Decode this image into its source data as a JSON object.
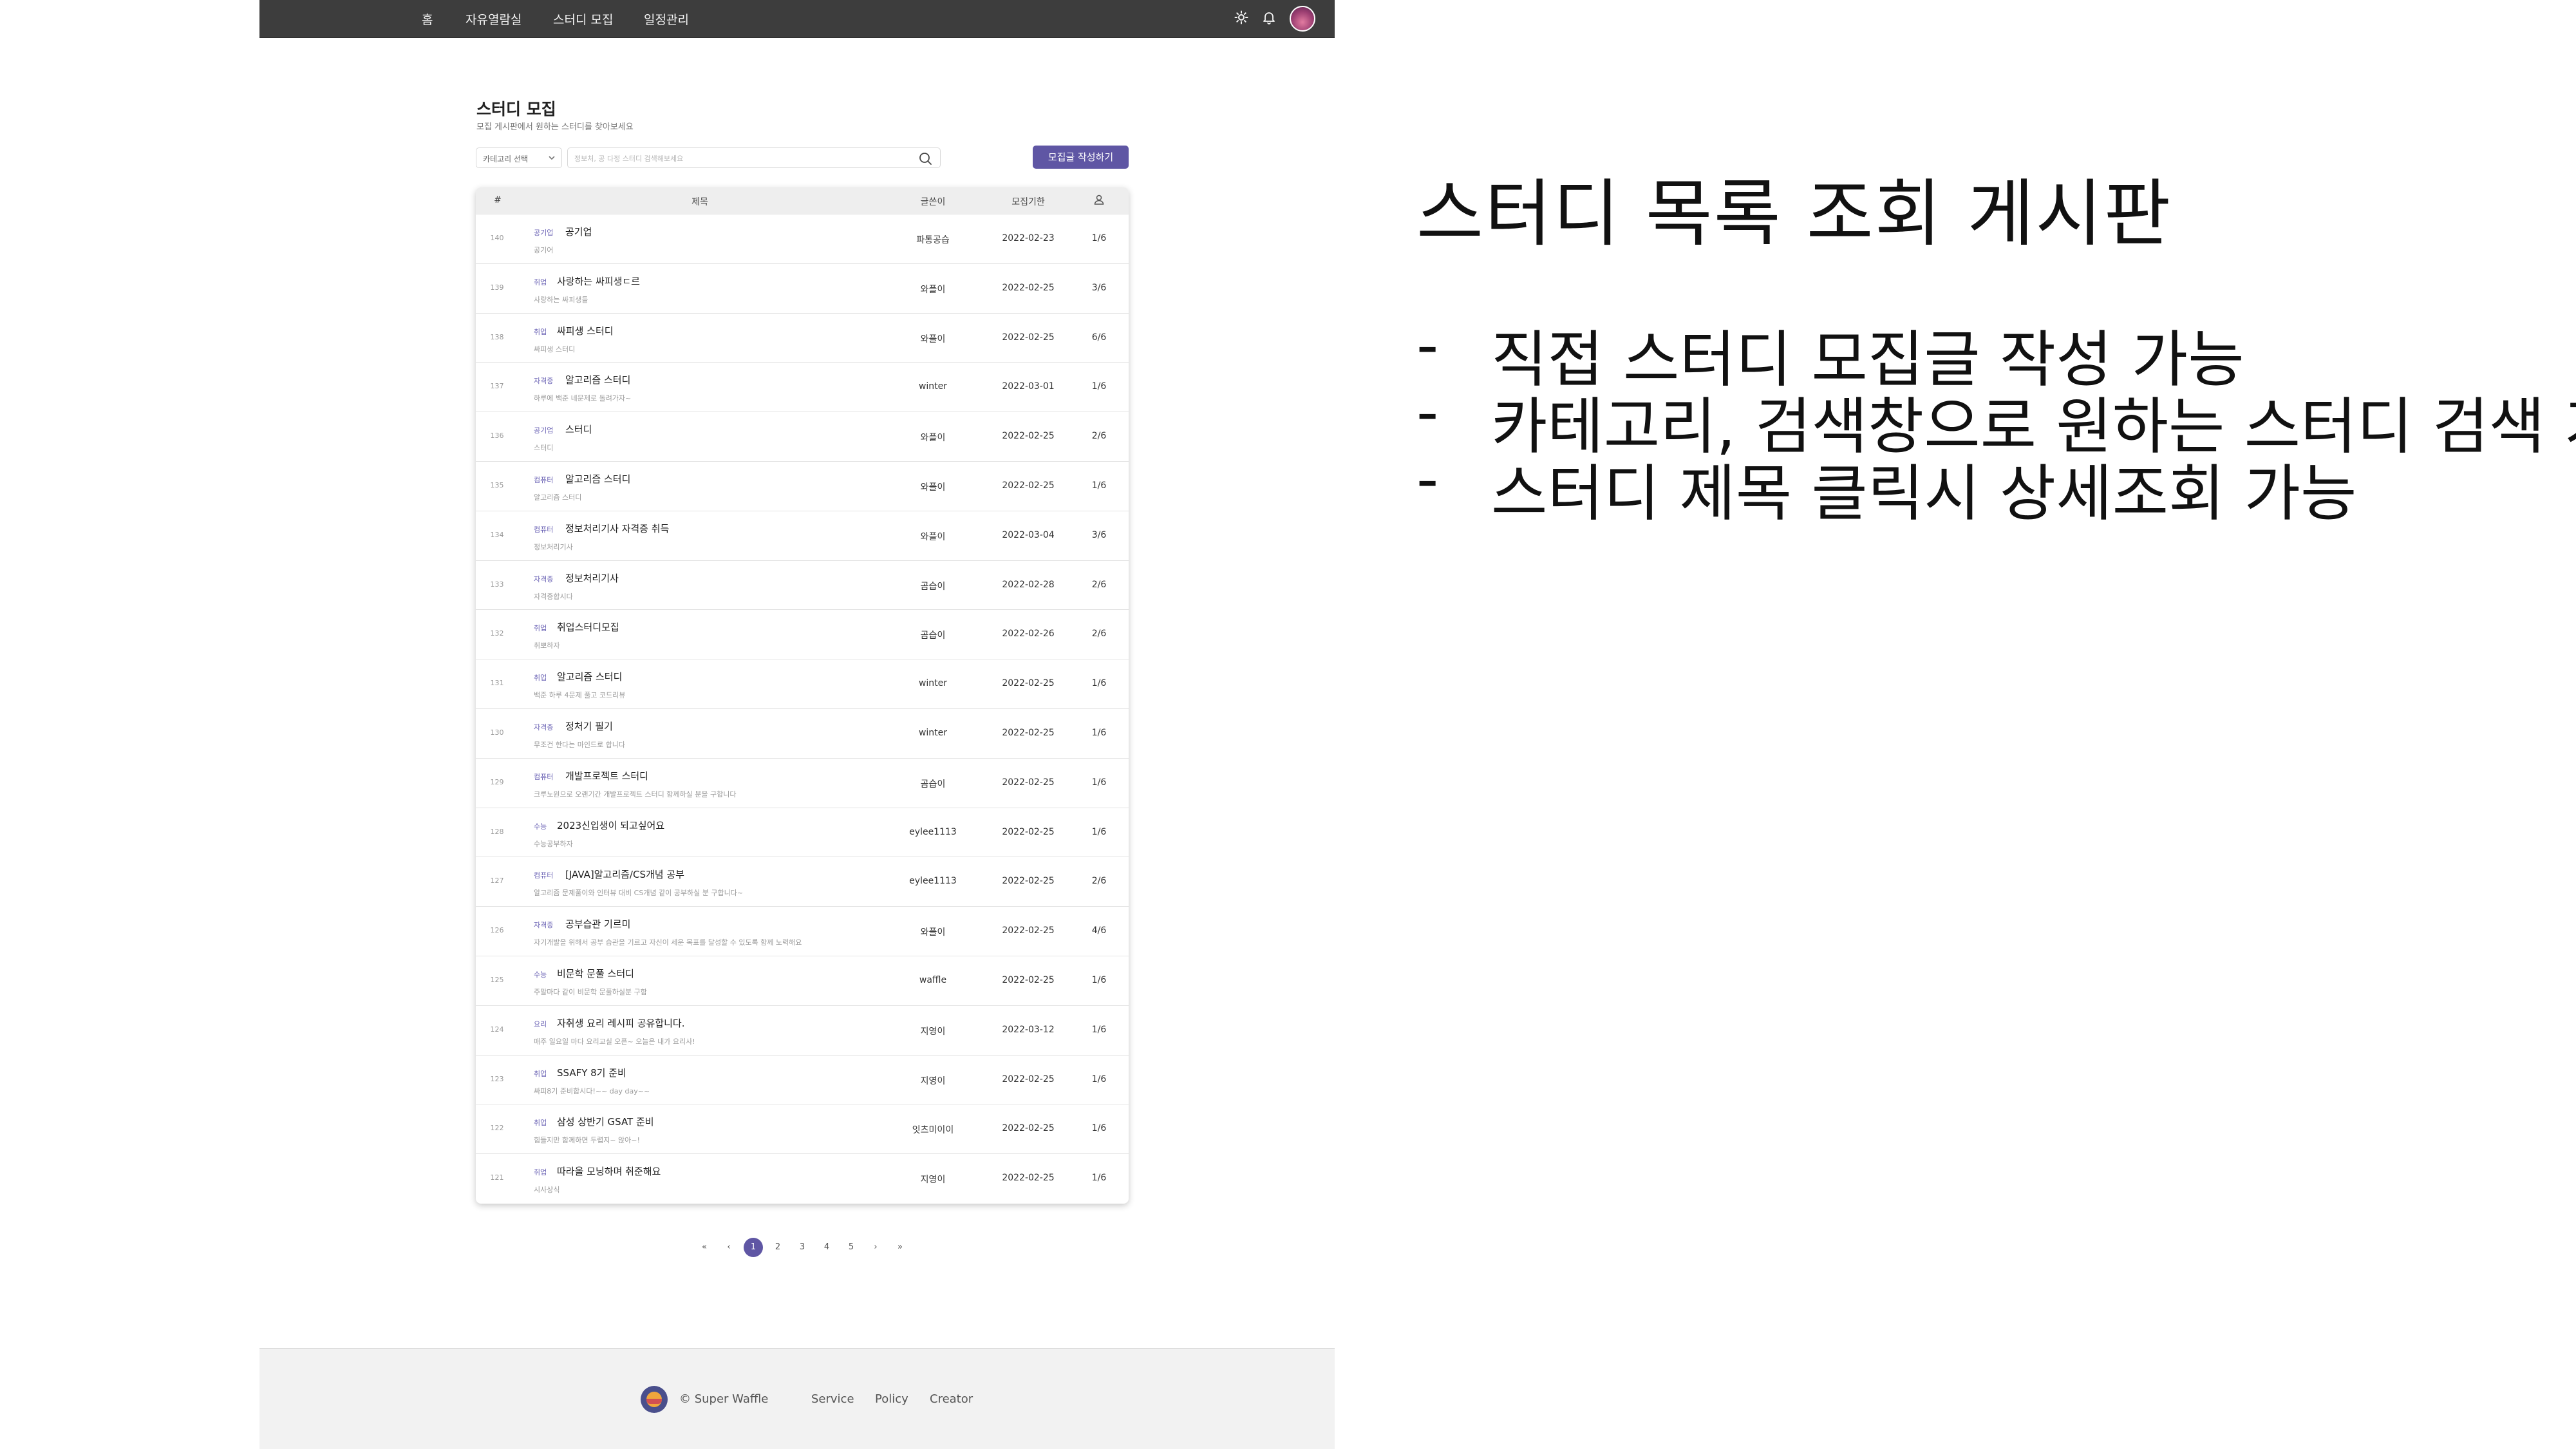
{
  "navbar": {
    "links": [
      "홈",
      "자유열람실",
      "스터디 모집",
      "일정관리"
    ]
  },
  "page": {
    "title": "스터디 모집",
    "subtitle": "모집 게시판에서 원하는 스터디를 찾아보세요"
  },
  "search": {
    "category_label": "카테고리 선택",
    "placeholder": "정보처, 공 다정 스터디 검색해보세요",
    "write_button": "모집글 작성하기"
  },
  "table": {
    "headers": [
      "#",
      "제목",
      "글쓴이",
      "모집기한"
    ],
    "rows": [
      {
        "num": "140",
        "category": "공기업",
        "title": "공기업",
        "desc": "공기어",
        "author": "파통공습",
        "deadline": "2022-02-23",
        "members": "1/6"
      },
      {
        "num": "139",
        "category": "취업",
        "title": "사랑하는 싸피생ㄷ르",
        "desc": "사랑하는 싸피생들",
        "author": "와플이",
        "deadline": "2022-02-25",
        "members": "3/6"
      },
      {
        "num": "138",
        "category": "취업",
        "title": "싸피생 스터디",
        "desc": "싸피생 스터디",
        "author": "와플이",
        "deadline": "2022-02-25",
        "members": "6/6"
      },
      {
        "num": "137",
        "category": "자격증",
        "title": "알고리즘 스터디",
        "desc": "하루에 백준 네문제로 돌려가자~",
        "author": "winter",
        "deadline": "2022-03-01",
        "members": "1/6"
      },
      {
        "num": "136",
        "category": "공기업",
        "title": "스터디",
        "desc": "스터디",
        "author": "와플이",
        "deadline": "2022-02-25",
        "members": "2/6"
      },
      {
        "num": "135",
        "category": "컴퓨터",
        "title": "알고리즘 스터디",
        "desc": "알고리즘 스터디",
        "author": "와플이",
        "deadline": "2022-02-25",
        "members": "1/6"
      },
      {
        "num": "134",
        "category": "컴퓨터",
        "title": "정보처리기사 자격증 취득",
        "desc": "정보처리기사",
        "author": "와플이",
        "deadline": "2022-03-04",
        "members": "3/6"
      },
      {
        "num": "133",
        "category": "자격증",
        "title": "정보처리기사",
        "desc": "자격증합시다",
        "author": "곰습이",
        "deadline": "2022-02-28",
        "members": "2/6"
      },
      {
        "num": "132",
        "category": "취업",
        "title": "취업스터디모집",
        "desc": "취뽀하자",
        "author": "곰습이",
        "deadline": "2022-02-26",
        "members": "2/6"
      },
      {
        "num": "131",
        "category": "취업",
        "title": "알고리즘 스터디",
        "desc": "백준 하루 4문제 풀고 코드리뷰",
        "author": "winter",
        "deadline": "2022-02-25",
        "members": "1/6"
      },
      {
        "num": "130",
        "category": "자격증",
        "title": "정처기 필기",
        "desc": "무조건 한다는 마인드로 합니다",
        "author": "winter",
        "deadline": "2022-02-25",
        "members": "1/6"
      },
      {
        "num": "129",
        "category": "컴퓨터",
        "title": "개발프로젝트 스터디",
        "desc": "크루노원으로 오랜기간 개발프로젝트 스터디 함께하실 분을 구합니다",
        "author": "곰습이",
        "deadline": "2022-02-25",
        "members": "1/6"
      },
      {
        "num": "128",
        "category": "수능",
        "title": "2023신입생이 되고싶어요",
        "desc": "수능공부하자",
        "author": "eylee1113",
        "deadline": "2022-02-25",
        "members": "1/6"
      },
      {
        "num": "127",
        "category": "컴퓨터",
        "title": "[JAVA]알고리즘/CS개념 공부",
        "desc": "알고리즘 문제풀이와 인터뷰 대비 CS개념 같이 공부하실 분 구합니다~",
        "author": "eylee1113",
        "deadline": "2022-02-25",
        "members": "2/6"
      },
      {
        "num": "126",
        "category": "자격증",
        "title": "공부습관 기르미",
        "desc": "자기개발을 위해서 공부 습관을 기르고 자신이 세운 목표를 달성할 수 있도록 함께 노력해요",
        "author": "와플이",
        "deadline": "2022-02-25",
        "members": "4/6"
      },
      {
        "num": "125",
        "category": "수능",
        "title": "비문학 문풀 스터디",
        "desc": "주말마다 같이 비문학 문풀하실분 구함",
        "author": "waffle",
        "deadline": "2022-02-25",
        "members": "1/6"
      },
      {
        "num": "124",
        "category": "요리",
        "title": "자취생 요리 레시피 공유합니다.",
        "desc": "매주 일요일 마다 요리교실 오픈~ 오늘은 내가 요리사!",
        "author": "지영이",
        "deadline": "2022-03-12",
        "members": "1/6"
      },
      {
        "num": "123",
        "category": "취업",
        "title": "SSAFY 8기 준비",
        "desc": "싸피8기 준비합시다!~~ day day~~",
        "author": "지영이",
        "deadline": "2022-02-25",
        "members": "1/6"
      },
      {
        "num": "122",
        "category": "취업",
        "title": "삼성 상반기 GSAT 준비",
        "desc": "힘들지만 함께하면 두렵지~ 않아~!",
        "author": "잇츠미이이",
        "deadline": "2022-02-25",
        "members": "1/6"
      },
      {
        "num": "121",
        "category": "취업",
        "title": "따라올 모닝하며 취준해요",
        "desc": "시사상식",
        "author": "지영이",
        "deadline": "2022-02-25",
        "members": "1/6"
      }
    ]
  },
  "pagination": {
    "first": "«",
    "prev": "‹",
    "pages": [
      "1",
      "2",
      "3",
      "4",
      "5"
    ],
    "active": "1",
    "next": "›",
    "last": "»"
  },
  "footer": {
    "copyright": "© Super Waffle",
    "links": [
      "Service",
      "Policy",
      "Creator"
    ]
  },
  "slide": {
    "title": "스터디 목록 조회 게시판",
    "bullets": [
      "직접 스터디 모집글 작성 가능",
      "카테고리, 검색창으로 원하는 스터디 검색 가능",
      "스터디 제목 클릭시 상세조회 가능"
    ],
    "dash": "-"
  },
  "icons": {
    "theme": "sun-icon",
    "notifications": "bell-icon",
    "search": "search-icon",
    "members": "person-icon",
    "category_dropdown": "chevron-down-icon"
  },
  "colors": {
    "navbar": "#3d3d3d",
    "accent": "#5f56a4",
    "category_text": "#6b63b5"
  }
}
